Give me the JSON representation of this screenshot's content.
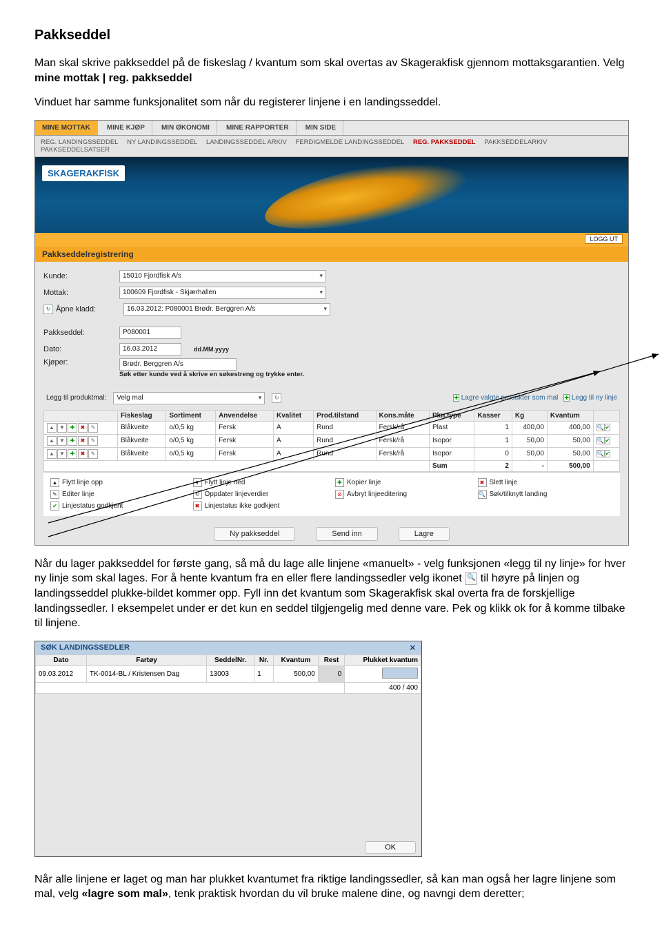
{
  "doc": {
    "title": "Pakkseddel",
    "p1a": "Man skal skrive pakkseddel på de fiskeslag / kvantum som skal overtas av Skagerakfisk gjennom mottaksgarantien. Velg ",
    "p1b": "mine mottak | reg. pakkseddel",
    "p2": "Vinduet har samme funksjonalitet som når du registerer linjene i en landingsseddel.",
    "p3a": "Når du lager pakkseddel for første gang, så må du lage alle linjene «manuelt» - velg funksjonen «legg til ny linje» for hver ny linje som skal lages. For å hente kvantum fra en eller flere landingssedler velg ikonet ",
    "p3b": " til høyre på linjen og landingsseddel plukke-bildet kommer opp. Fyll inn det kvantum som Skagerakfisk skal overta fra de forskjellige landingssedler. I eksempelet under er det kun en seddel tilgjengelig med denne vare. Pek og klikk ok for å komme tilbake til linjene.",
    "p4a": "Når alle linjene er laget og man har plukket kvantumet fra riktige landingssedler, så kan man også her lagre linjene som mal, velg ",
    "p4b": "«lagre som mal»",
    "p4c": ", tenk praktisk hvordan du vil bruke malene dine, og navngi dem deretter;"
  },
  "ui": {
    "tabs_main": [
      "MINE MOTTAK",
      "MINE KJØP",
      "MIN ØKONOMI",
      "MINE RAPPORTER",
      "MIN SIDE"
    ],
    "tabs_sub": [
      "REG. LANDINGSSEDDEL",
      "NY LANDINGSSEDDEL",
      "LANDINGSSEDDEL ARKIV",
      "FERDIGMELDE LANDINGSSEDDEL",
      "REG. PAKKSEDDEL",
      "PAKKSEDDELARKIV",
      "PAKKSEDDELSATSER"
    ],
    "logo": "SKAGERAKFISK",
    "logout": "LOGG UT",
    "section": "Pakkseddelregistrering",
    "form": {
      "kunde_lbl": "Kunde:",
      "kunde_val": "15010 Fjordfisk A/s",
      "mottak_lbl": "Mottak:",
      "mottak_val": "100609 Fjordfisk - Skjærhallen",
      "kladd_lbl": "Åpne kladd:",
      "kladd_val": "16.03.2012: P080001 Brødr. Berggren A/s",
      "pakk_lbl": "Pakkseddel:",
      "pakk_val": "P080001",
      "dato_lbl": "Dato:",
      "dato_val": "16.03.2012",
      "dato_fmt": "dd.MM.yyyy",
      "kjoper_lbl": "Kjøper:",
      "kjoper_val": "Brødr. Berggren A/s",
      "kjoper_note": "Søk etter kunde ved å skrive en søkestreng og trykke enter.",
      "mal_lbl": "Legg til produktmal:",
      "mal_val": "Velg mal",
      "lagre_mal": "Lagre valgte produkter som mal",
      "ny_linje": "Legg til ny linje"
    },
    "cols": [
      "Fiskeslag",
      "Sortiment",
      "Anvendelse",
      "Kvalitet",
      "Prod.tilstand",
      "Kons.måte",
      "Pkn.type",
      "Kasser",
      "Kg",
      "Kvantum"
    ],
    "rows": [
      {
        "fisk": "Blåkveite",
        "sort": "o/0,5 kg",
        "anv": "Fersk",
        "kval": "A",
        "prod": "Rund",
        "kons": "Fersk/rå",
        "pkn": "Plast",
        "kasser": "1",
        "kg": "400,00",
        "kv": "400,00"
      },
      {
        "fisk": "Blåkveite",
        "sort": "o/0,5 kg",
        "anv": "Fersk",
        "kval": "A",
        "prod": "Rund",
        "kons": "Fersk/rå",
        "pkn": "Isopor",
        "kasser": "1",
        "kg": "50,00",
        "kv": "50,00"
      },
      {
        "fisk": "Blåkveite",
        "sort": "o/0,5 kg",
        "anv": "Fersk",
        "kval": "A",
        "prod": "Rund",
        "kons": "Fersk/rå",
        "pkn": "Isopor",
        "kasser": "0",
        "kg": "50,00",
        "kv": "50,00"
      }
    ],
    "sum_lbl": "Sum",
    "sum_kasser": "2",
    "sum_kv": "500,00",
    "legend": [
      "Flytt linje opp",
      "Flytt linje ned",
      "Kopier linje",
      "Slett linje",
      "Editer linje",
      "Oppdater linjeverdier",
      "Avbryt linjeeditering",
      "Søk/tilknytt landing",
      "Linjestatus godkjent",
      "Linjestatus ikke godkjent"
    ],
    "btns": [
      "Ny pakkseddel",
      "Send inn",
      "Lagre"
    ]
  },
  "modal": {
    "title": "SØK LANDINGSSEDLER",
    "cols": [
      "Dato",
      "Fartøy",
      "SeddelNr.",
      "Nr.",
      "Kvantum",
      "Rest",
      "Plukket kvantum"
    ],
    "row": {
      "dato": "09.03.2012",
      "fartoy": "TK-0014-BL / Kristensen Dag",
      "snr": "13003",
      "nr": "1",
      "kv": "500,00",
      "rest": "0"
    },
    "total": "400 / 400",
    "ok": "OK"
  }
}
